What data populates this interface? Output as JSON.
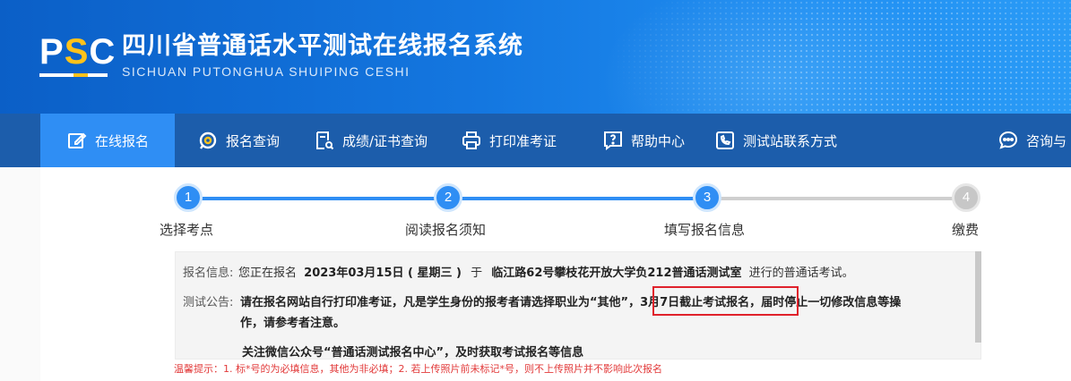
{
  "header": {
    "logo_text": "PSC",
    "title": "四川省普通话水平测试在线报名系统",
    "subtitle": "SICHUAN PUTONGHUA SHUIPING CESHI"
  },
  "nav": {
    "items": [
      {
        "label": "在线报名",
        "icon": "edit-icon"
      },
      {
        "label": "报名查询",
        "icon": "search-icon"
      },
      {
        "label": "成绩/证书查询",
        "icon": "certificate-search-icon"
      },
      {
        "label": "打印准考证",
        "icon": "printer-icon"
      },
      {
        "label": "帮助中心",
        "icon": "help-icon"
      },
      {
        "label": "测试站联系方式",
        "icon": "contact-icon"
      },
      {
        "label": "咨询与",
        "icon": "chat-icon"
      }
    ]
  },
  "steps": [
    {
      "num": "1",
      "label": "选择考点",
      "done": true
    },
    {
      "num": "2",
      "label": "阅读报名须知",
      "done": true
    },
    {
      "num": "3",
      "label": "填写报名信息",
      "done": true
    },
    {
      "num": "4",
      "label": "缴费",
      "done": false
    }
  ],
  "info": {
    "registration_label": "报名信息:",
    "registration_prefix": "您正在报名",
    "registration_date": "2023年03月15日 ( 星期三 )",
    "registration_mid": "于",
    "registration_place": "临江路62号攀枝花开放大学负212普通话测试室",
    "registration_suffix": "进行的普通话考试。",
    "notice_label": "测试公告:",
    "notice_line1_a": "请在报名网站自行打印准考证，凡是学生身份的报考者请选择职业为“其他”",
    "notice_line1_b": "，3月7日截止考试报名，",
    "notice_line1_c": "届时停止一切修改信息等操",
    "notice_line2": "作，请参考者注意。",
    "notice_line3": "关注微信公众号“普通话测试报名中心”，及时获取考试报名等信息"
  },
  "hint": "温馨提示：1. 标*号的为必填信息，其他为非必填；2. 若上传照片前未标记*号，则不上传照片并不影响此次报名",
  "colors": {
    "banner": "#1477e0",
    "nav": "#1c5dab",
    "nav_active": "#2f8ef4",
    "step_active": "#2f8ef4",
    "step_inactive": "#c7c7c7",
    "highlight": "#e0212b",
    "logo_accent": "#ffc21a"
  }
}
